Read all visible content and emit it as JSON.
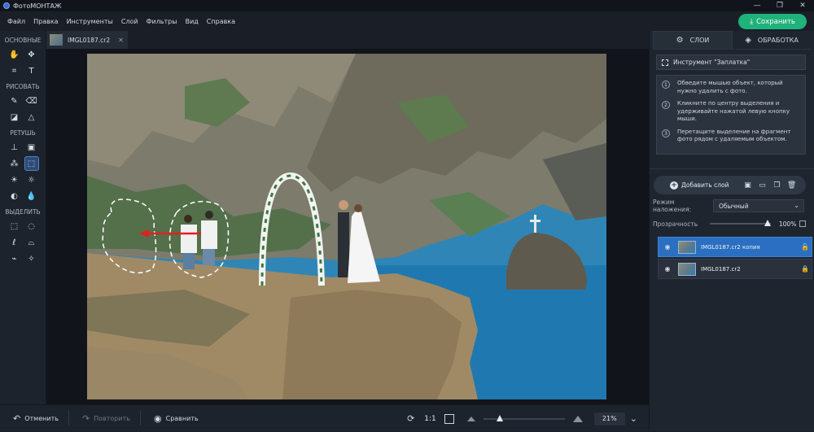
{
  "app": {
    "title": "ФотоМОНТАЖ"
  },
  "window": {
    "minimize": "—",
    "maximize": "❐",
    "close": "✕"
  },
  "menu": {
    "items": [
      "Файл",
      "Правка",
      "Инструменты",
      "Слой",
      "Фильтры",
      "Вид",
      "Справка"
    ]
  },
  "save_button": {
    "label": "Сохранить"
  },
  "tools": {
    "sections": [
      {
        "label": "ОСНОВНЫЕ",
        "tools": [
          {
            "name": "hand-tool",
            "glyph": "✋"
          },
          {
            "name": "move-tool",
            "glyph": "✥"
          },
          {
            "name": "crop-tool",
            "glyph": "⌗"
          },
          {
            "name": "text-tool",
            "glyph": "T"
          }
        ]
      },
      {
        "label": "РИСОВАТЬ",
        "tools": [
          {
            "name": "brush-tool",
            "glyph": "✎"
          },
          {
            "name": "eraser-tool",
            "glyph": "⌫"
          },
          {
            "name": "fill-tool",
            "glyph": "◪"
          },
          {
            "name": "shapes-tool",
            "glyph": "△"
          }
        ]
      },
      {
        "label": "РЕТУШЬ",
        "tools": [
          {
            "name": "stamp-tool",
            "glyph": "⊥"
          },
          {
            "name": "healing-tool",
            "glyph": "▣"
          },
          {
            "name": "clone-tool",
            "glyph": "⁂"
          },
          {
            "name": "patch-tool",
            "glyph": "⬚",
            "selected": true
          },
          {
            "name": "brightness-tool",
            "glyph": "☀"
          },
          {
            "name": "exposure-tool",
            "glyph": "☼"
          },
          {
            "name": "blur-tool",
            "glyph": "◐"
          },
          {
            "name": "sharpen-tool",
            "glyph": "💧"
          }
        ]
      },
      {
        "label": "ВЫДЕЛИТЬ",
        "tools": [
          {
            "name": "rect-select-tool",
            "glyph": "⬚"
          },
          {
            "name": "ellipse-select-tool",
            "glyph": "◌"
          },
          {
            "name": "lasso-tool",
            "glyph": "ℓ"
          },
          {
            "name": "poly-lasso-tool",
            "glyph": "⌓"
          },
          {
            "name": "quick-select-tool",
            "glyph": "⌁"
          },
          {
            "name": "magic-wand-tool",
            "glyph": "✧"
          }
        ]
      }
    ]
  },
  "document_tab": {
    "name": "IMGL0187.cr2",
    "close": "✕"
  },
  "bottom_bar": {
    "undo": "Отменить",
    "redo": "Повторить",
    "compare": "Сравнить",
    "ratio": "1:1",
    "zoom_value": "21%",
    "zoom_level": 0.16
  },
  "right_panel": {
    "tabs": [
      {
        "label": "СЛОИ",
        "active": true
      },
      {
        "label": "ОБРАБОТКА",
        "active": false
      }
    ],
    "tool_title": "Инструмент \"Заплатка\"",
    "steps": [
      {
        "num": "1",
        "text": "Обведите мышью объект, который нужно удалить с фото."
      },
      {
        "num": "2",
        "text": "Кликните по центру выделения и удерживайте нажатой левую кнопку мыши."
      },
      {
        "num": "3",
        "text": "Перетащите выделение на фрагмент фото рядом с удаляемым объектом."
      }
    ],
    "add_layer": "Добавить слой",
    "blend_label": "Режим наложения:",
    "blend_value": "Обычный",
    "opacity_label": "Прозрачность",
    "opacity_value": "100%",
    "layers": [
      {
        "name": "IMGL0187.cr2 копия",
        "selected": true,
        "locked": false
      },
      {
        "name": "IMGL0187.cr2",
        "selected": false,
        "locked": true
      }
    ]
  },
  "colors": {
    "accent": "#1fb27a",
    "selection": "#2a6fc1",
    "background": "#1a1f27"
  }
}
